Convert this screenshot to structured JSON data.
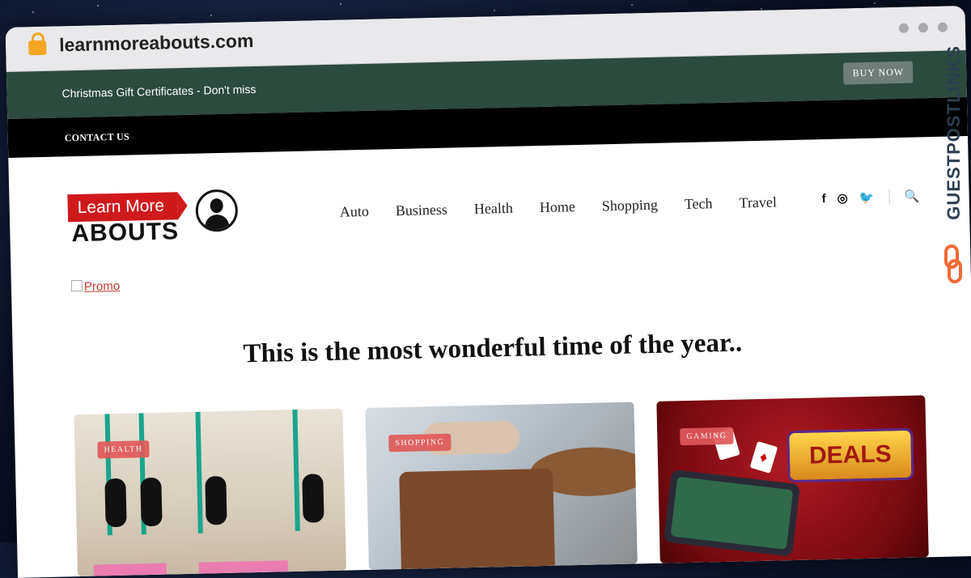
{
  "browser": {
    "url": "learnmoreabouts.com"
  },
  "topbar": {
    "promo_text": "Christmas Gift Certificates - Don't miss",
    "buy_now": "BUY NOW"
  },
  "secondary_nav": {
    "contact": "CONTACT US"
  },
  "logo": {
    "line1": "Learn More",
    "line2": "ABOUTS"
  },
  "nav": {
    "items": [
      "Auto",
      "Business",
      "Health",
      "Home",
      "Shopping",
      "Tech",
      "Travel"
    ]
  },
  "social": {
    "facebook": "f",
    "instagram": "◎",
    "twitter": "🐦",
    "search": "🔍"
  },
  "promo_image": {
    "alt": "Promo"
  },
  "headline": "This is the most wonderful time of the year..",
  "cards": [
    {
      "tag": "HEALTH",
      "icon": "yoga-photo"
    },
    {
      "tag": "SHOPPING",
      "icon": "leather-bag-photo"
    },
    {
      "tag": "GAMING",
      "icon": "casino-deals-photo",
      "banner_text": "DEALS"
    }
  ],
  "watermark": {
    "text": "GUESTPOSTLINKS"
  }
}
